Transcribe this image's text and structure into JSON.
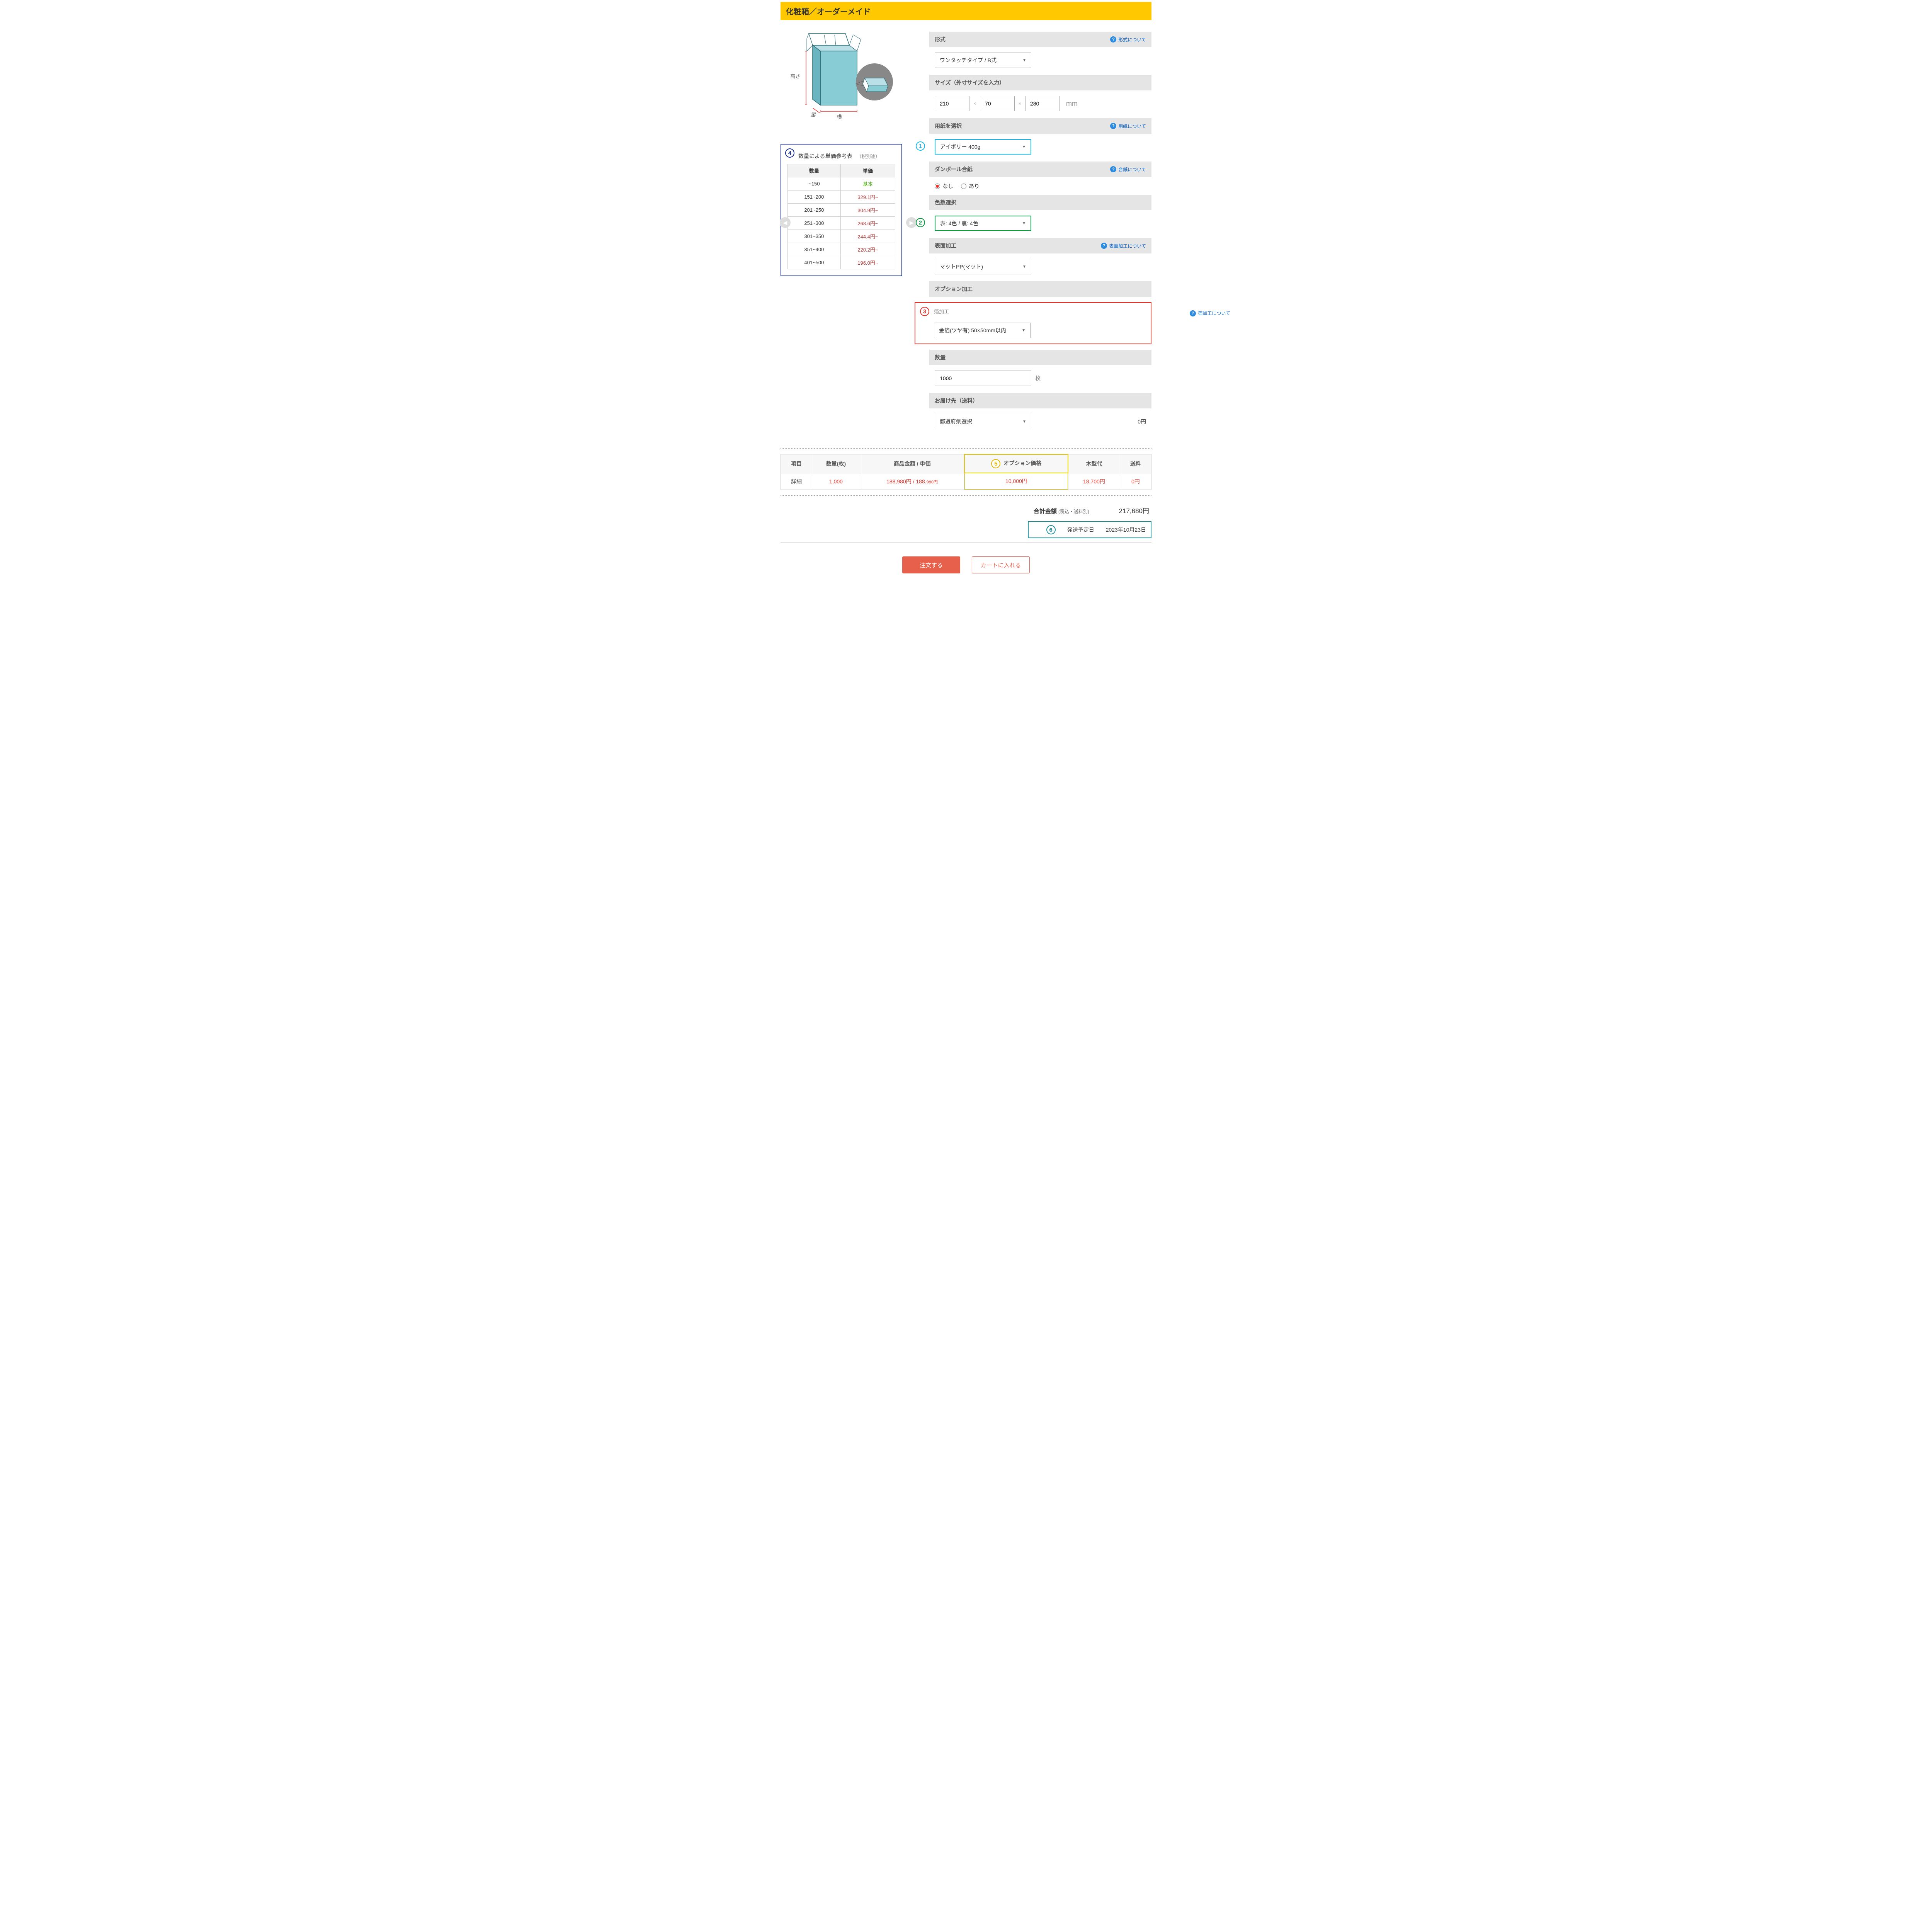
{
  "title": "化粧箱／オーダーメイド",
  "box_labels": {
    "height": "高さ",
    "depth": "縦",
    "width": "横"
  },
  "sections": {
    "format": {
      "label": "形式",
      "help": "形式について",
      "value": "ワンタッチタイプ / B式"
    },
    "size": {
      "label": "サイズ（外寸サイズを入力）",
      "w": "210",
      "d": "70",
      "h": "280",
      "unit": "mm"
    },
    "paper": {
      "label": "用紙を選択",
      "help": "用紙について",
      "value": "アイボリー 400g"
    },
    "laminate": {
      "label": "ダンボール合紙",
      "help": "合紙について",
      "opts": [
        "なし",
        "あり"
      ],
      "selected": 0
    },
    "colors": {
      "label": "色数選択",
      "value": "表: 4色 / 裏: 4色"
    },
    "surface": {
      "label": "表面加工",
      "help": "表面加工について",
      "value": "マットPP(マット)"
    },
    "option": {
      "label": "オプション加工"
    },
    "foil": {
      "label": "箔加工",
      "help": "箔加工について",
      "value": "金箔(ツヤ有) 50×50mm以内"
    },
    "qty": {
      "label": "数量",
      "value": "1000",
      "unit": "枚"
    },
    "ship": {
      "label": "お届け先（送料）",
      "value": "都道府県選択",
      "amount": "0円"
    }
  },
  "price_ref": {
    "title": "数量による単価参考表",
    "tax": "（税別途）",
    "headers": [
      "数量",
      "単価"
    ],
    "rows": [
      {
        "q": "~150",
        "p": "基本",
        "base": true
      },
      {
        "q": "151~200",
        "p": "329.1円~"
      },
      {
        "q": "201~250",
        "p": "304.9円~"
      },
      {
        "q": "251~300",
        "p": "268.6円~"
      },
      {
        "q": "301~350",
        "p": "244.4円~"
      },
      {
        "q": "351~400",
        "p": "220.2円~"
      },
      {
        "q": "401~500",
        "p": "196.0円~"
      }
    ]
  },
  "summary": {
    "headers": [
      "項目",
      "数量(枚)",
      "商品金額 / 単価",
      "オプション価格",
      "木型代",
      "送料"
    ],
    "row_label": "詳細",
    "qty": "1,000",
    "amount_main": "188,980円 / 188.",
    "amount_sub": "980円",
    "option": "10,000円",
    "die": "18,700円",
    "ship": "0円"
  },
  "totals": {
    "label": "合計金額",
    "sub": "(税込・送料別)",
    "value": "217,680円",
    "ship_label": "発送予定日",
    "ship_date": "2023年10月23日"
  },
  "buttons": {
    "order": "注文する",
    "cart": "カートに入れる"
  },
  "callouts": {
    "1": "1",
    "2": "2",
    "3": "3",
    "4": "4",
    "5": "5",
    "6": "6"
  }
}
